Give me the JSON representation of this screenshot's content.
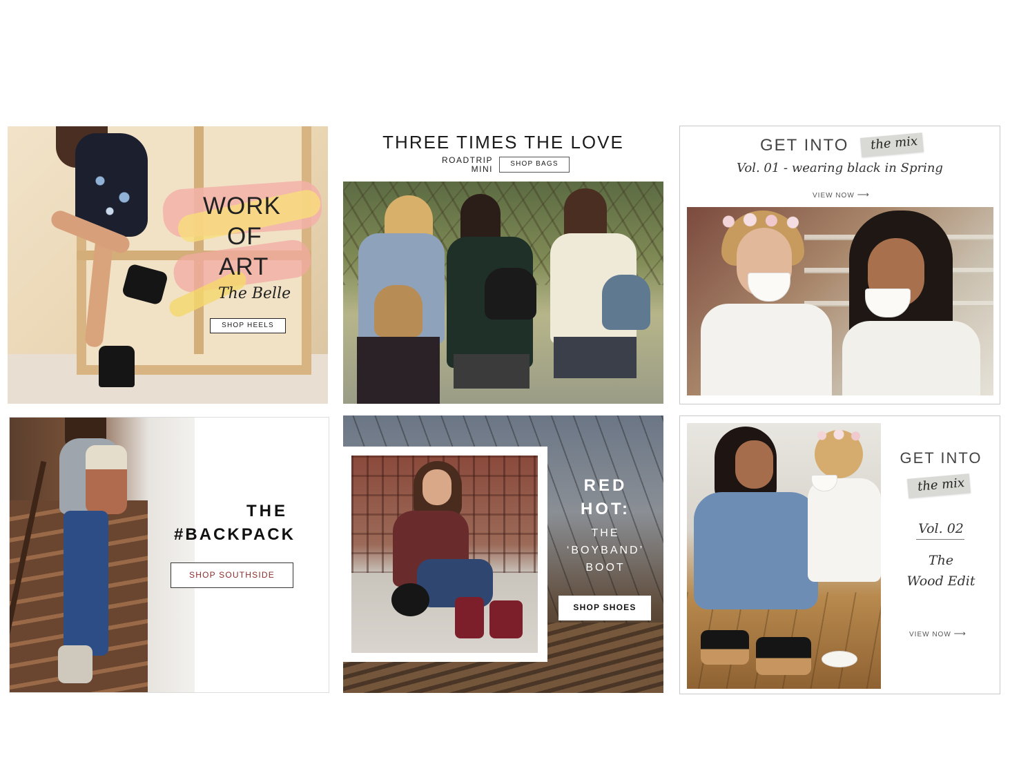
{
  "tiles": {
    "work_of_art": {
      "headline": [
        "WORK",
        "OF",
        "ART"
      ],
      "subtitle": "The Belle",
      "cta": "SHOP HEELS"
    },
    "three_times": {
      "headline": "THREE TIMES THE LOVE",
      "product_line1": "ROADTRIP",
      "product_line2": "MINI",
      "cta": "SHOP BAGS"
    },
    "mix_vol1": {
      "heading": "GET INTO",
      "tape_label": "the mix",
      "subtitle": "Vol. 01 - wearing black in Spring",
      "link": "VIEW NOW"
    },
    "backpack": {
      "headline_line1": "THE",
      "headline_line2": "#BACKPACK",
      "cta": "SHOP SOUTHSIDE"
    },
    "red_hot": {
      "headline_line1": "RED",
      "headline_line2": "HOT:",
      "sub_line1": "THE",
      "sub_line2": "‘BOYBAND’",
      "sub_line3": "BOOT",
      "cta": "SHOP SHOES"
    },
    "mix_vol2": {
      "heading": "GET INTO",
      "tape_label": "the mix",
      "volume": "Vol. 02",
      "title_line1": "The",
      "title_line2": "Wood Edit",
      "link": "VIEW NOW"
    }
  },
  "colors": {
    "accent_red": "#8b2b2b",
    "ink": "#1a1a1a",
    "tape": "#d9d9d5"
  }
}
